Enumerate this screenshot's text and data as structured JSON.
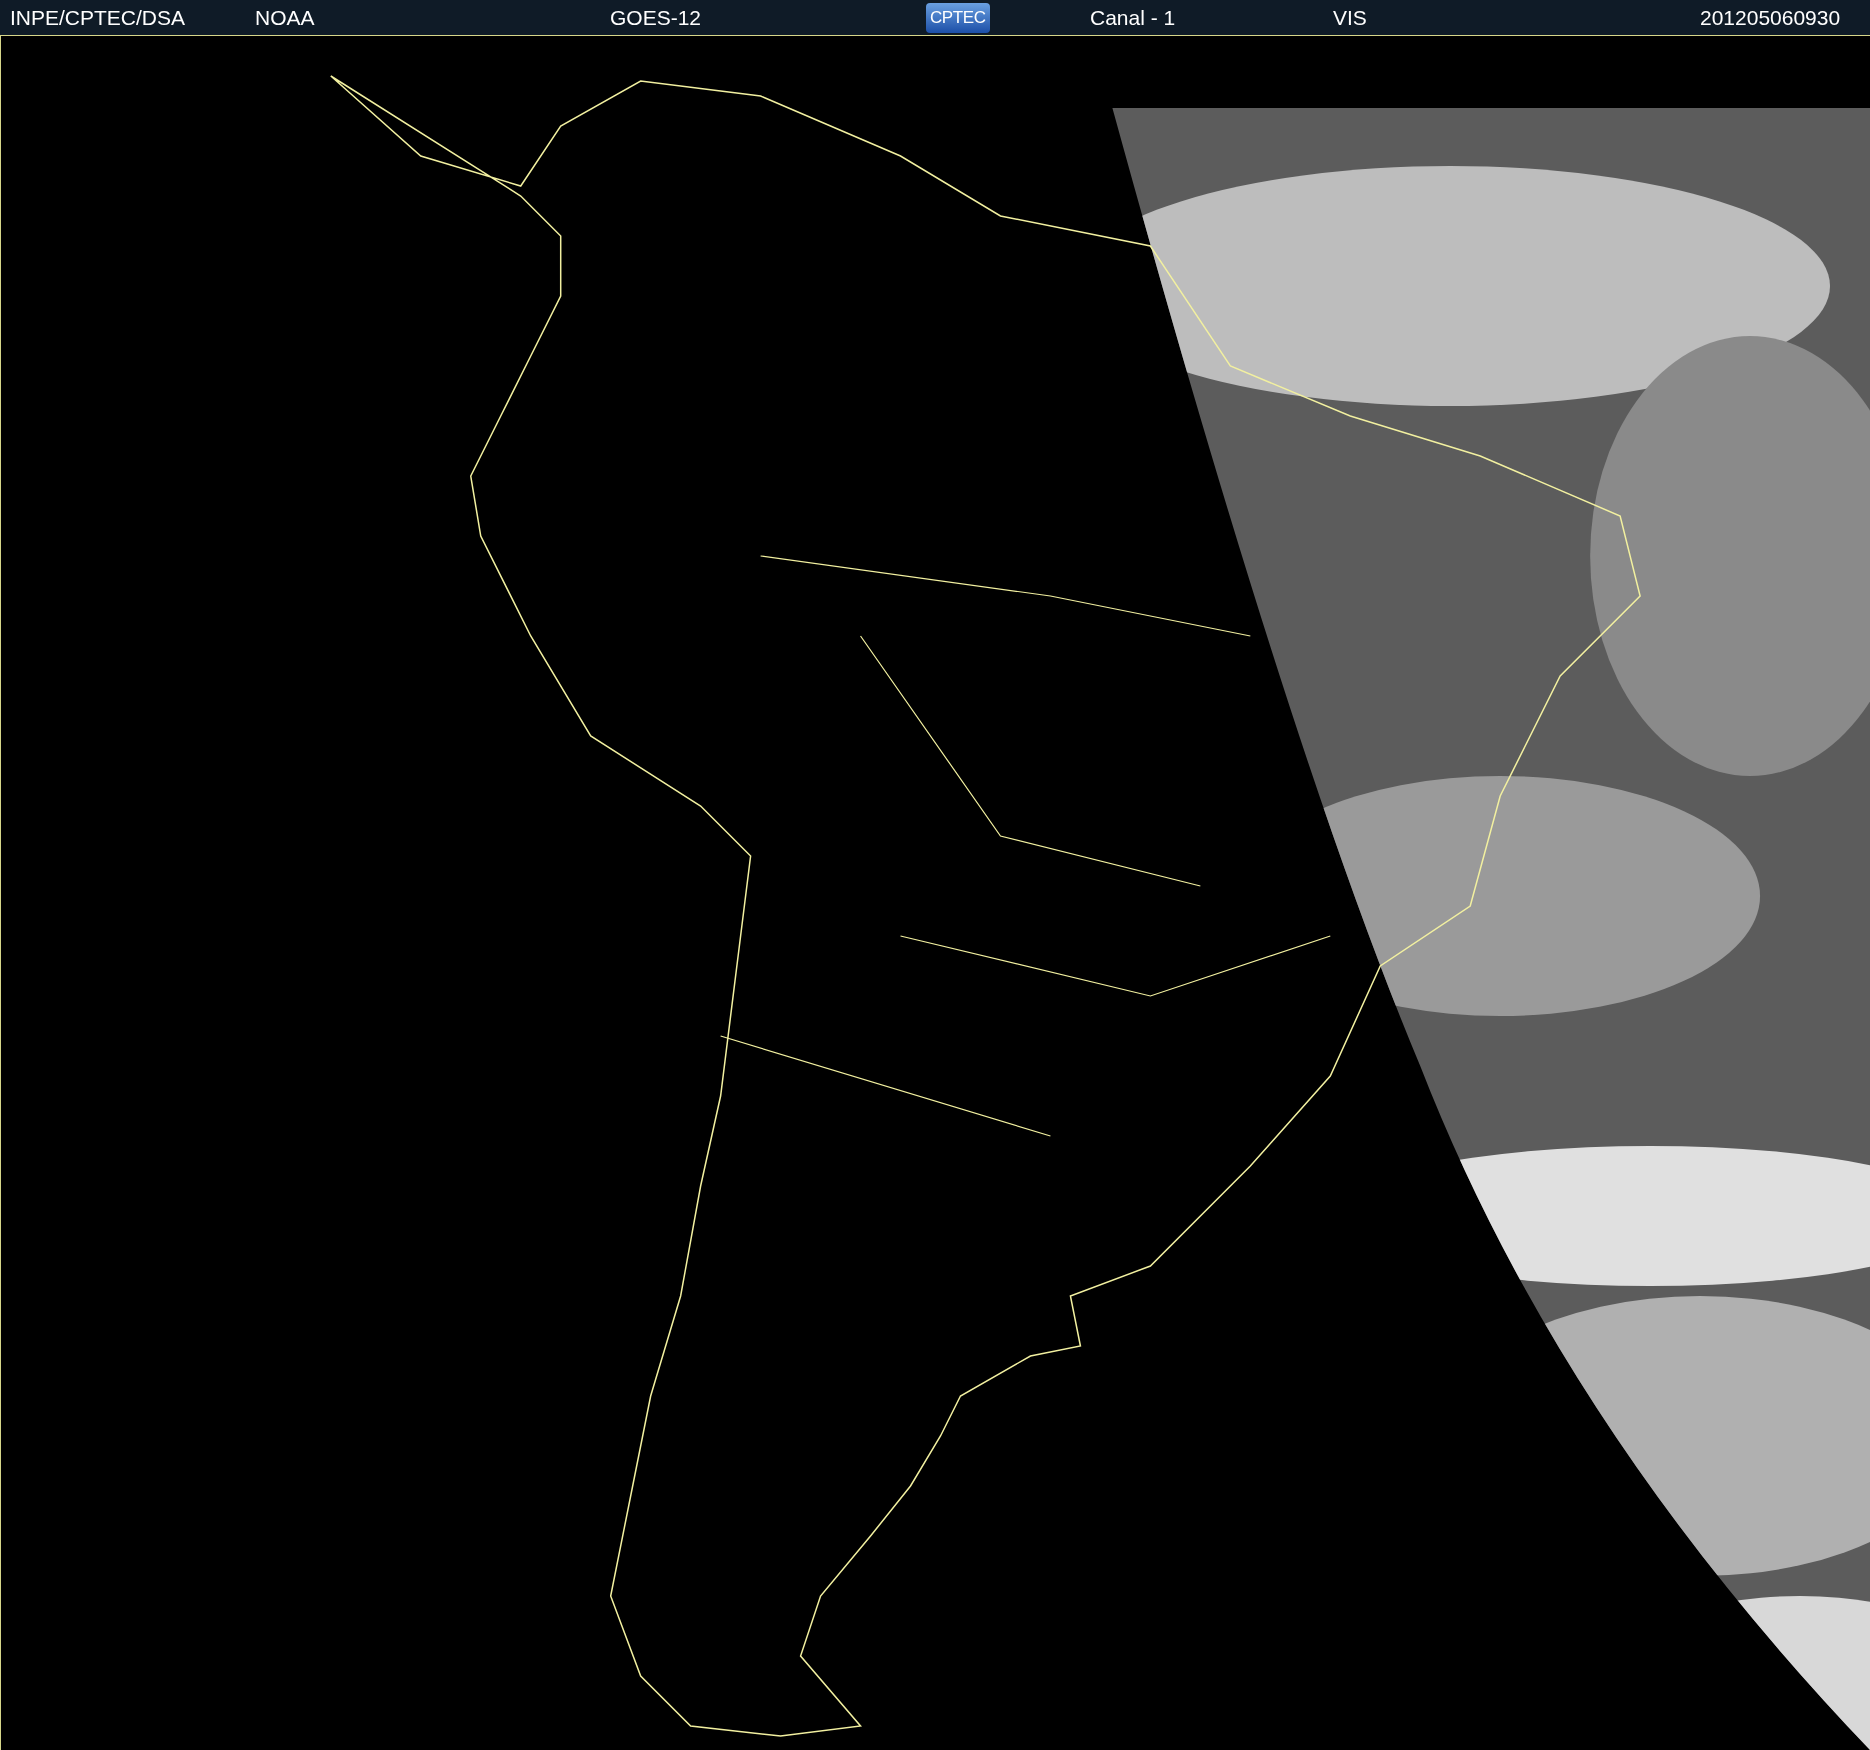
{
  "header": {
    "items": [
      {
        "kind": "text",
        "text": "INPE/CPTEC/DSA"
      },
      {
        "kind": "text",
        "text": "NOAA"
      },
      {
        "kind": "text",
        "text": "GOES-12"
      },
      {
        "kind": "logo",
        "text": "CPTEC"
      },
      {
        "kind": "text",
        "text": "Canal - 1"
      },
      {
        "kind": "text",
        "text": "VIS"
      },
      {
        "kind": "text",
        "text": "201205060930"
      }
    ]
  }
}
